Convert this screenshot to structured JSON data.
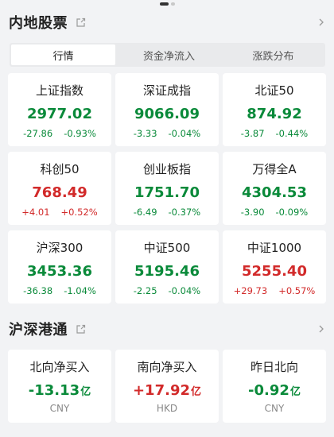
{
  "mainland": {
    "title": "内地股票",
    "tabs": [
      {
        "label": "行情",
        "active": true
      },
      {
        "label": "资金净流入",
        "active": false
      },
      {
        "label": "涨跌分布",
        "active": false
      }
    ],
    "indices": [
      {
        "name": "上证指数",
        "value": "2977.02",
        "change": "-27.86",
        "pct": "-0.93%",
        "dir": "down"
      },
      {
        "name": "深证成指",
        "value": "9066.09",
        "change": "-3.33",
        "pct": "-0.04%",
        "dir": "down"
      },
      {
        "name": "北证50",
        "value": "874.92",
        "change": "-3.87",
        "pct": "-0.44%",
        "dir": "down"
      },
      {
        "name": "科创50",
        "value": "768.49",
        "change": "+4.01",
        "pct": "+0.52%",
        "dir": "up"
      },
      {
        "name": "创业板指",
        "value": "1751.70",
        "change": "-6.49",
        "pct": "-0.37%",
        "dir": "down"
      },
      {
        "name": "万得全A",
        "value": "4304.53",
        "change": "-3.90",
        "pct": "-0.09%",
        "dir": "down"
      },
      {
        "name": "沪深300",
        "value": "3453.36",
        "change": "-36.38",
        "pct": "-1.04%",
        "dir": "down"
      },
      {
        "name": "中证500",
        "value": "5195.46",
        "change": "-2.25",
        "pct": "-0.04%",
        "dir": "down"
      },
      {
        "name": "中证1000",
        "value": "5255.40",
        "change": "+29.73",
        "pct": "+0.57%",
        "dir": "up"
      }
    ]
  },
  "connect": {
    "title": "沪深港通",
    "flows": [
      {
        "name": "北向净买入",
        "value": "-13.13",
        "unit": "亿",
        "currency": "CNY",
        "dir": "down"
      },
      {
        "name": "南向净买入",
        "value": "+17.92",
        "unit": "亿",
        "currency": "HKD",
        "dir": "up"
      },
      {
        "name": "昨日北向",
        "value": "-0.92",
        "unit": "亿",
        "currency": "CNY",
        "dir": "down"
      }
    ]
  },
  "colors": {
    "down": "#0a8a3a",
    "up": "#d22a2a",
    "background": "#f2f3f5",
    "card": "#ffffff"
  },
  "icons": {
    "share": "share-out-icon",
    "chevron": "chevron-right-icon"
  }
}
